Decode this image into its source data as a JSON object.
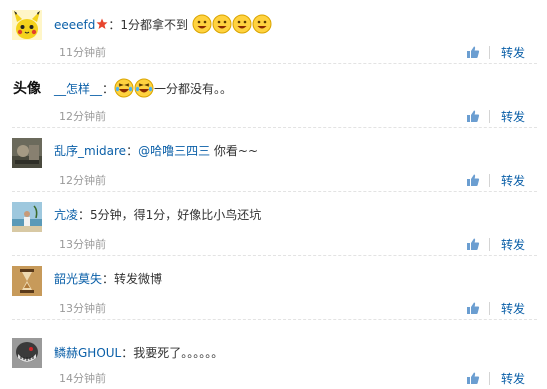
{
  "comments": [
    {
      "username": "eeeefd",
      "has_vip_badge": true,
      "text_before": "1分都拿不到",
      "emoji_after_count": 4,
      "emoji_name": "grin-face-emoji",
      "time": "11分钟前",
      "repost": "转发",
      "avatar": "pikachu-avatar"
    },
    {
      "username": "__怎样__",
      "emoji_before_count": 2,
      "emoji_name": "laughing-tears-emoji",
      "text_after": "一分都没有。。",
      "time": "12分钟前",
      "repost": "转发",
      "avatar_text": "头像"
    },
    {
      "username": "乱序_midare",
      "mention": "@哈噜三四三",
      "text_after": " 你看~~",
      "time": "12分钟前",
      "repost": "转发",
      "avatar": "photo-avatar"
    },
    {
      "username": "亢凌",
      "text": "5分钟，得1分，好像比小鸟还坑",
      "time": "13分钟前",
      "repost": "转发",
      "avatar": "beach-avatar"
    },
    {
      "username": "韶光莫失",
      "text": "转发微博",
      "time": "13分钟前",
      "repost": "转发",
      "avatar": "hourglass-avatar"
    },
    {
      "username": "鳞赫GHOUL",
      "text": "我要死了。。。。。。",
      "time": "14分钟前",
      "repost": "转发",
      "avatar": "mask-avatar"
    }
  ],
  "colors": {
    "link": "#0a5fa8",
    "time": "#9a9a9a",
    "text": "#333333"
  }
}
